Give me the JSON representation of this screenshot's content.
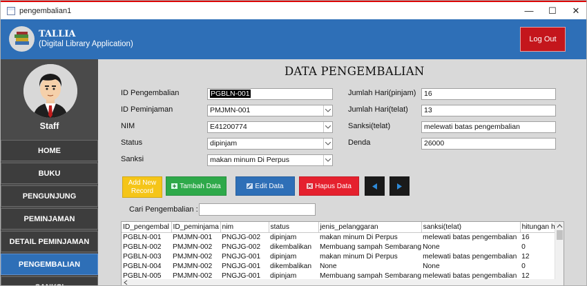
{
  "window": {
    "title": "pengembalian1"
  },
  "app": {
    "name": "TALLIA",
    "subtitle": "(Digital Library Application)",
    "logout_label": "Log Out"
  },
  "sidebar": {
    "user_role": "Staff",
    "items": [
      {
        "label": "HOME",
        "active": false
      },
      {
        "label": "BUKU",
        "active": false
      },
      {
        "label": "PENGUNJUNG",
        "active": false
      },
      {
        "label": "PEMINJAMAN",
        "active": false
      },
      {
        "label": "DETAIL PEMINJAMAN",
        "active": false
      },
      {
        "label": "PENGEMBALIAN",
        "active": true
      },
      {
        "label": "SANKSI",
        "active": false
      }
    ]
  },
  "page": {
    "title": "DATA PENGEMBALIAN"
  },
  "form": {
    "id_pengembalian": {
      "label": "ID Pengembalian",
      "value": "PGBLN-001"
    },
    "id_peminjaman": {
      "label": "ID Peminjaman",
      "value": "PMJMN-001"
    },
    "nim": {
      "label": "NIM",
      "value": "E41200774"
    },
    "status": {
      "label": "Status",
      "value": "dipinjam"
    },
    "sanksi": {
      "label": "Sanksi",
      "value": "makan minum Di Perpus"
    },
    "jumlah_hari_pinjam": {
      "label": "Jumlah Hari(pinjam)",
      "value": "16"
    },
    "jumlah_hari_telat": {
      "label": "Jumlah Hari(telat)",
      "value": "13"
    },
    "sanksi_telat": {
      "label": "Sanksi(telat)",
      "value": "melewati batas pengembalian"
    },
    "denda": {
      "label": "Denda",
      "value": "26000"
    }
  },
  "buttons": {
    "add_new": "Add New Record",
    "tambah": "Tambah Data",
    "edit": "Edit Data",
    "hapus": "Hapus Data"
  },
  "search": {
    "label": "Cari Pengembalian :",
    "value": ""
  },
  "colors": {
    "header": "#2e6fb7",
    "logout": "#c4161c",
    "add_new": "#f5c518",
    "tambah": "#2ea94a",
    "edit": "#2e6fb7",
    "hapus": "#e5212e",
    "nav": "#1a1a1a"
  },
  "table": {
    "columns": [
      "ID_pengembal",
      "ID_peminjama",
      "nim",
      "status",
      "jenis_pelanggaran",
      "sanksi(telat)",
      "hitungan ha"
    ],
    "rows": [
      [
        "PGBLN-001",
        "PMJMN-001",
        "PNGJG-002",
        "dipinjam",
        "makan minum Di Perpus",
        "melewati batas pengembalian",
        "16"
      ],
      [
        "PGBLN-002",
        "PMJMN-002",
        "PNGJG-002",
        "dikembalikan",
        "Membuang sampah Sembarang",
        "None",
        "0"
      ],
      [
        "PGBLN-003",
        "PMJMN-002",
        "PNGJG-001",
        "dipinjam",
        "makan minum Di Perpus",
        "melewati batas pengembalian",
        "12"
      ],
      [
        "PGBLN-004",
        "PMJMN-002",
        "PNGJG-001",
        "dikembalikan",
        "None",
        "None",
        "0"
      ],
      [
        "PGBLN-005",
        "PMJMN-002",
        "PNGJG-001",
        "dipinjam",
        "Membuang sampah Sembarang",
        "melewati batas pengembalian",
        "12"
      ]
    ]
  }
}
